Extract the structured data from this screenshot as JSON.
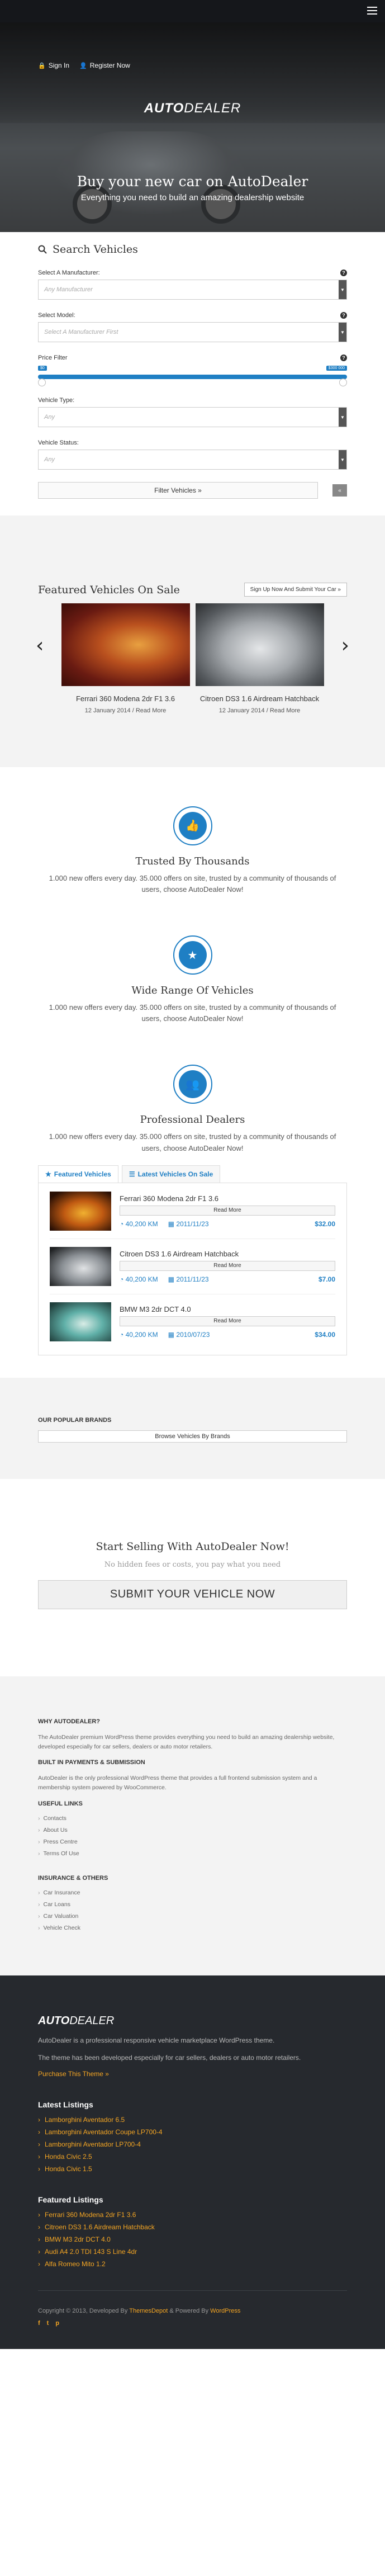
{
  "topbar": {
    "menu_icon": "hamburger-icon"
  },
  "header": {
    "sign_in": "Sign In",
    "register": "Register Now",
    "logo_a": "AUTO",
    "logo_b": "DEALER",
    "title": "Buy your new car on AutoDealer",
    "subtitle": "Everything you need to build an amazing dealership website"
  },
  "search": {
    "heading": "Search Vehicles",
    "manufacturer_label": "Select A Manufacturer:",
    "manufacturer_placeholder": "Any Manufacturer",
    "model_label": "Select Model:",
    "model_placeholder": "Select A Manufacturer First",
    "price_label": "Price Filter",
    "price_min": "$0",
    "price_max": "$300 000",
    "price_range_fraction": [
      0.0,
      1.0
    ],
    "type_label": "Vehicle Type:",
    "type_placeholder": "Any",
    "status_label": "Vehicle Status:",
    "status_placeholder": "Any",
    "filter_button": "Filter Vehicles »",
    "reset_button": "«"
  },
  "featured": {
    "heading": "Featured Vehicles On Sale",
    "signup_button": "Sign Up Now And Submit Your Car »",
    "cars": [
      {
        "name": "Ferrari 360 Modena 2dr F1 3.6",
        "date": "12 January 2014 / Read More"
      },
      {
        "name": "Citroen DS3 1.6 Airdream Hatchback",
        "date": "12 January 2014 / Read More"
      }
    ]
  },
  "features": [
    {
      "title": "Trusted By Thousands",
      "text": "1.000 new offers every day. 35.000 offers on site, trusted by a community of thousands of users, choose AutoDealer Now!",
      "icon": "thumbs-up-icon"
    },
    {
      "title": "Wide Range Of Vehicles",
      "text": "1.000 new offers every day. 35.000 offers on site, trusted by a community of thousands of users, choose AutoDealer Now!",
      "icon": "star-icon"
    },
    {
      "title": "Professional Dealers",
      "text": "1.000 new offers every day. 35.000 offers on site, trusted by a community of thousands of users, choose AutoDealer Now!",
      "icon": "users-icon"
    }
  ],
  "tabs": {
    "featured_tab": "Featured Vehicles",
    "latest_tab": "Latest Vehicles On Sale",
    "items": [
      {
        "title": "Ferrari 360 Modena 2dr F1 3.6",
        "read_more": "Read More",
        "km": "40,200 KM",
        "date": "2011/11/23",
        "price": "$32.00"
      },
      {
        "title": "Citroen DS3 1.6 Airdream Hatchback",
        "read_more": "Read More",
        "km": "40,200 KM",
        "date": "2011/11/23",
        "price": "$7.00"
      },
      {
        "title": "BMW M3 2dr DCT 4.0",
        "read_more": "Read More",
        "km": "40,200 KM",
        "date": "2010/07/23",
        "price": "$34.00"
      }
    ]
  },
  "brands": {
    "heading": "OUR POPULAR BRANDS",
    "button": "Browse Vehicles By Brands"
  },
  "sell": {
    "heading": "Start Selling With AutoDealer Now!",
    "sub": "No hidden fees or costs, you pay what you need",
    "button": "SUBMIT YOUR VEHICLE NOW"
  },
  "info": {
    "why_heading": "WHY AUTODEALER?",
    "why_text": "The AutoDealer premium WordPress theme provides everything you need to build an amazing dealership website, developed especially for car sellers, dealers or auto motor retailers.",
    "payments_heading": "BUILT IN PAYMENTS & SUBMISSION",
    "payments_text": "AutoDealer is the only professional WordPress theme that provides a full frontend submission system and a membership system powered by WooCommerce.",
    "links_heading": "USEFUL LINKS",
    "links": [
      "Contacts",
      "About Us",
      "Press Centre",
      "Terms Of Use"
    ],
    "insurance_heading": "INSURANCE & OTHERS",
    "insurance": [
      "Car Insurance",
      "Car Loans",
      "Car Valuation",
      "Vehicle Check"
    ]
  },
  "footer": {
    "logo_a": "AUTO",
    "logo_b": "DEALER",
    "about": "AutoDealer is a professional responsive vehicle marketplace WordPress theme.",
    "about2": "The theme has been developed especially for car sellers, dealers or auto motor retailers.",
    "purchase": "Purchase This Theme »",
    "latest_heading": "Latest Listings",
    "latest": [
      "Lamborghini Aventador 6.5",
      "Lamborghini Aventador Coupe LP700-4",
      "Lamborghini Aventador LP700-4",
      "Honda Civic 2.5",
      "Honda Civic 1.5"
    ],
    "featured_heading": "Featured Listings",
    "featured": [
      "Ferrari 360 Modena 2dr F1 3.6",
      "Citroen DS3 1.6 Airdream Hatchback",
      "BMW M3 2dr DCT 4.0",
      "Audi A4 2.0 TDI 143 S Line 4dr",
      "Alfa Romeo Mito 1.2"
    ],
    "copy_prefix": "Copyright © 2013, Developed By ",
    "copy_dev": "ThemesDepot",
    "copy_mid": " & Powered By ",
    "copy_wp": "WordPress",
    "social": [
      "f",
      "t",
      "p"
    ]
  },
  "colors": {
    "accent": "#1f7fc4",
    "orange": "#f5a623",
    "dark": "#26292e"
  }
}
